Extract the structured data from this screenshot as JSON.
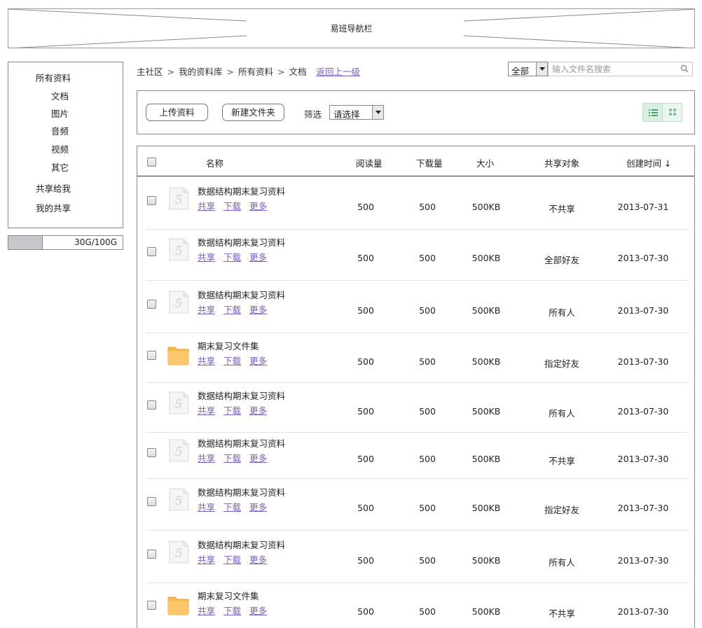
{
  "topnav": {
    "label": "易班导航栏"
  },
  "sidebar": {
    "items": [
      {
        "label": "所有资料"
      },
      {
        "label": "文档"
      },
      {
        "label": "图片"
      },
      {
        "label": "音频"
      },
      {
        "label": "视频"
      },
      {
        "label": "其它"
      },
      {
        "label": "共享给我"
      },
      {
        "label": "我的共享"
      }
    ],
    "quota": {
      "text": "30G/100G",
      "used_fraction": 0.3
    }
  },
  "breadcrumb": {
    "items": [
      "主社区",
      "我的资料库",
      "所有资料",
      "文档"
    ],
    "separator": ">",
    "back_link": "返回上一级"
  },
  "search": {
    "scope_value": "全部",
    "placeholder": "输入文件名搜索"
  },
  "toolbar": {
    "upload_label": "上传资料",
    "new_folder_label": "新建文件夹",
    "filter_label": "筛选",
    "filter_value": "请选择"
  },
  "table": {
    "headers": {
      "name": "名称",
      "reads": "阅读量",
      "downloads": "下载量",
      "size": "大小",
      "share": "共享对象",
      "created": "创建时间",
      "sort_indicator": "↓"
    },
    "actions": [
      "共享",
      "下载",
      "更多"
    ],
    "rows": [
      {
        "type": "file",
        "name": "数据结构期末复习资料",
        "reads": "500",
        "downloads": "500",
        "size": "500KB",
        "share": "不共享",
        "created": "2013-07-31"
      },
      {
        "type": "file",
        "name": "数据结构期末复习资料",
        "reads": "500",
        "downloads": "500",
        "size": "500KB",
        "share": "全部好友",
        "created": "2013-07-30"
      },
      {
        "type": "file",
        "name": "数据结构期末复习资料",
        "reads": "500",
        "downloads": "500",
        "size": "500KB",
        "share": "所有人",
        "created": "2013-07-30"
      },
      {
        "type": "folder",
        "name": "期末复习文件集",
        "reads": "500",
        "downloads": "500",
        "size": "500KB",
        "share": "指定好友",
        "created": "2013-07-30"
      },
      {
        "type": "file",
        "name": "数据结构期末复习资料",
        "reads": "500",
        "downloads": "500",
        "size": "500KB",
        "share": "所有人",
        "created": "2013-07-30"
      },
      {
        "type": "file",
        "name": "数据结构期末复习资料",
        "reads": "500",
        "downloads": "500",
        "size": "500KB",
        "share": "不共享",
        "created": "2013-07-30"
      },
      {
        "type": "file",
        "name": "数据结构期末复习资料",
        "reads": "500",
        "downloads": "500",
        "size": "500KB",
        "share": "指定好友",
        "created": "2013-07-30"
      },
      {
        "type": "file",
        "name": "数据结构期末复习资料",
        "reads": "500",
        "downloads": "500",
        "size": "500KB",
        "share": "所有人",
        "created": "2013-07-30"
      },
      {
        "type": "folder",
        "name": "期末复习文件集",
        "reads": "500",
        "downloads": "500",
        "size": "500KB",
        "share": "不共享",
        "created": "2013-07-30"
      }
    ]
  },
  "colors": {
    "link": "#7b5cc4",
    "border": "#888888",
    "folder": "#f7b84a",
    "view_toggle": "#6fb78f"
  }
}
